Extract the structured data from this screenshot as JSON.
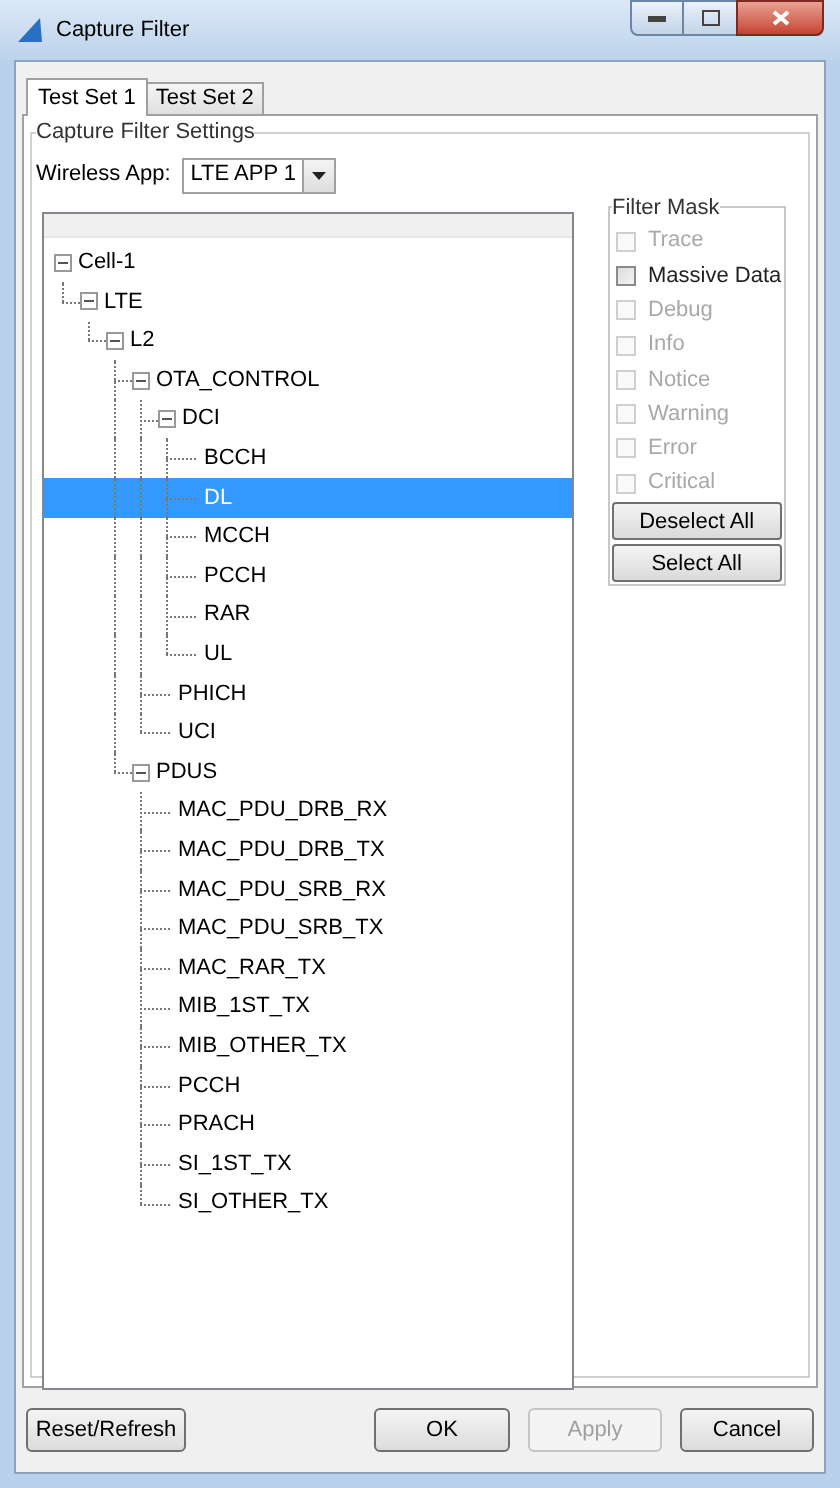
{
  "window": {
    "title": "Capture Filter"
  },
  "tabs": [
    {
      "label": "Test Set 1",
      "selected": true
    },
    {
      "label": "Test Set 2",
      "selected": false
    }
  ],
  "settings": {
    "title": "Capture Filter Settings",
    "wireless_app": {
      "label": "Wireless App:",
      "value": "LTE APP 1"
    }
  },
  "tree": [
    {
      "label": "Cell-1",
      "expanded": true,
      "selected": false,
      "children": [
        {
          "label": "LTE",
          "expanded": true,
          "selected": false,
          "children": [
            {
              "label": "L2",
              "expanded": true,
              "selected": false,
              "children": [
                {
                  "label": "OTA_CONTROL",
                  "expanded": true,
                  "selected": false,
                  "children": [
                    {
                      "label": "DCI",
                      "expanded": true,
                      "selected": false,
                      "children": [
                        {
                          "label": "BCCH",
                          "selected": false
                        },
                        {
                          "label": "DL",
                          "selected": true
                        },
                        {
                          "label": "MCCH",
                          "selected": false
                        },
                        {
                          "label": "PCCH",
                          "selected": false
                        },
                        {
                          "label": "RAR",
                          "selected": false
                        },
                        {
                          "label": "UL",
                          "selected": false
                        }
                      ]
                    },
                    {
                      "label": "PHICH",
                      "selected": false
                    },
                    {
                      "label": "UCI",
                      "selected": false
                    }
                  ]
                },
                {
                  "label": "PDUS",
                  "expanded": true,
                  "selected": false,
                  "children": [
                    {
                      "label": "MAC_PDU_DRB_RX",
                      "selected": false
                    },
                    {
                      "label": "MAC_PDU_DRB_TX",
                      "selected": false
                    },
                    {
                      "label": "MAC_PDU_SRB_RX",
                      "selected": false
                    },
                    {
                      "label": "MAC_PDU_SRB_TX",
                      "selected": false
                    },
                    {
                      "label": "MAC_RAR_TX",
                      "selected": false
                    },
                    {
                      "label": "MIB_1ST_TX",
                      "selected": false
                    },
                    {
                      "label": "MIB_OTHER_TX",
                      "selected": false
                    },
                    {
                      "label": "PCCH",
                      "selected": false
                    },
                    {
                      "label": "PRACH",
                      "selected": false
                    },
                    {
                      "label": "SI_1ST_TX",
                      "selected": false
                    },
                    {
                      "label": "SI_OTHER_TX",
                      "selected": false
                    }
                  ]
                }
              ]
            }
          ]
        }
      ]
    }
  ],
  "filter_mask": {
    "title": "Filter Mask",
    "items": [
      {
        "label": "Trace",
        "checked": false,
        "disabled": true
      },
      {
        "label": "Massive Data",
        "checked": false,
        "disabled": false
      },
      {
        "label": "Debug",
        "checked": false,
        "disabled": true
      },
      {
        "label": "Info",
        "checked": false,
        "disabled": true
      },
      {
        "label": "Notice",
        "checked": false,
        "disabled": true
      },
      {
        "label": "Warning",
        "checked": false,
        "disabled": true
      },
      {
        "label": "Error",
        "checked": false,
        "disabled": true
      },
      {
        "label": "Critical",
        "checked": false,
        "disabled": true
      }
    ],
    "buttons": [
      "Deselect All",
      "Select All"
    ]
  },
  "buttons": [
    {
      "label": "Reset/Refresh",
      "disabled": false
    },
    {
      "label": "OK",
      "disabled": false
    },
    {
      "label": "Apply",
      "disabled": true
    },
    {
      "label": "Cancel",
      "disabled": false
    }
  ]
}
